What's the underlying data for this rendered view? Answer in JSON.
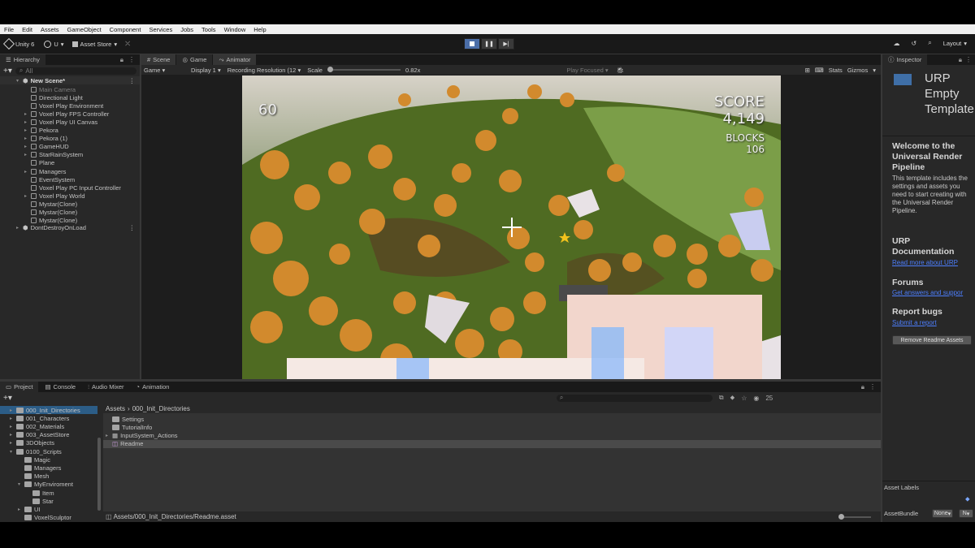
{
  "menu": [
    "File",
    "Edit",
    "Assets",
    "GameObject",
    "Component",
    "Services",
    "Jobs",
    "Tools",
    "Window",
    "Help"
  ],
  "toolbar": {
    "unity_version": "Unity 6",
    "account": "U",
    "asset_store": "Asset Store",
    "layout": "Layout"
  },
  "hierarchy": {
    "tab": "Hierarchy",
    "search_placeholder": "All",
    "scene": "New Scene*",
    "items": [
      {
        "label": "Main Camera",
        "muted": true,
        "arrow": false
      },
      {
        "label": "Directional Light",
        "arrow": false
      },
      {
        "label": "Voxel Play Environment",
        "arrow": false
      },
      {
        "label": "Voxel Play FPS Controller",
        "arrow": true
      },
      {
        "label": "Voxel Play UI Canvas",
        "arrow": true
      },
      {
        "label": "Pekora",
        "arrow": true
      },
      {
        "label": "Pekora (1)",
        "arrow": true
      },
      {
        "label": "GameHUD",
        "arrow": true
      },
      {
        "label": "StarRainSystem",
        "arrow": true
      },
      {
        "label": "Plane",
        "arrow": false
      },
      {
        "label": "Managers",
        "arrow": true
      },
      {
        "label": "EventSystem",
        "arrow": false
      },
      {
        "label": "Voxel Play PC Input Controller",
        "arrow": false
      },
      {
        "label": "Voxel Play World",
        "arrow": true
      },
      {
        "label": "Mystar(Clone)",
        "arrow": false
      },
      {
        "label": "Mystar(Clone)",
        "arrow": false
      },
      {
        "label": "Mystar(Clone)",
        "arrow": false
      }
    ],
    "dont_destroy": "DontDestroyOnLoad"
  },
  "center_tabs": [
    "Scene",
    "Game",
    "Animator"
  ],
  "game_bar": {
    "display_type": "Game",
    "display": "Display 1",
    "resolution": "Recording Resolution (12",
    "scale_label": "Scale",
    "scale_value": "0.82x",
    "play_focused": "Play Focused",
    "stats": "Stats",
    "gizmos": "Gizmos"
  },
  "hud": {
    "fps": "60",
    "score_label": "SCORE",
    "score": "4,149",
    "blocks_label": "BLOCKS",
    "blocks": "106"
  },
  "inspector": {
    "tab": "Inspector",
    "title": "URP Empty Template",
    "welcome_heading": "Welcome to the Universal Render Pipeline",
    "welcome_body": "This template includes the settings and assets you need to start creating with the Universal Render Pipeline.",
    "doc_heading": "URP Documentation",
    "doc_link": "Read more about URP",
    "forums_heading": "Forums",
    "forums_link": "Get answers and suppor",
    "bugs_heading": "Report bugs",
    "bugs_link": "Submit a report",
    "remove_button": "Remove Readme Assets",
    "asset_labels": "Asset Labels",
    "asset_bundle": "AssetBundle",
    "bundle_value": "None",
    "bundle_variant": "N"
  },
  "bottom_tabs": [
    "Project",
    "Console",
    "Audio Mixer",
    "Animation"
  ],
  "project_tree": [
    {
      "label": "000_Init_Directories",
      "depth": 1,
      "arrow": "▸",
      "sel": true
    },
    {
      "label": "001_Characters",
      "depth": 1,
      "arrow": "▸"
    },
    {
      "label": "002_Materials",
      "depth": 1,
      "arrow": "▸"
    },
    {
      "label": "003_AssetStore",
      "depth": 1,
      "arrow": "▸"
    },
    {
      "label": "3DObjects",
      "depth": 1,
      "arrow": "▸"
    },
    {
      "label": "0100_Scripts",
      "depth": 1,
      "arrow": "▾"
    },
    {
      "label": "Magic",
      "depth": 2,
      "arrow": ""
    },
    {
      "label": "Managers",
      "depth": 2,
      "arrow": ""
    },
    {
      "label": "Mesh",
      "depth": 2,
      "arrow": ""
    },
    {
      "label": "MyEnviroment",
      "depth": 2,
      "arrow": "▾"
    },
    {
      "label": "Item",
      "depth": 3,
      "arrow": ""
    },
    {
      "label": "Star",
      "depth": 3,
      "arrow": ""
    },
    {
      "label": "UI",
      "depth": 2,
      "arrow": "▸"
    },
    {
      "label": "VoxelSculptor",
      "depth": 2,
      "arrow": ""
    },
    {
      "label": "WrapVoxelPlay3",
      "depth": 2,
      "arrow": ""
    }
  ],
  "breadcrumb": [
    "Assets",
    "000_Init_Directories"
  ],
  "project_files": [
    {
      "label": "Settings",
      "type": "folder"
    },
    {
      "label": "TutorialInfo",
      "type": "folder"
    },
    {
      "label": "InputSystem_Actions",
      "type": "asset",
      "arrow": true
    },
    {
      "label": "Readme",
      "type": "readme",
      "sel": true
    }
  ],
  "project_count": "25",
  "status_path": "Assets/000_Init_Directories/Readme.asset",
  "colors": {
    "selection": "#2c5d87",
    "link": "#4c7efc",
    "play_active": "#4b6ea8"
  }
}
